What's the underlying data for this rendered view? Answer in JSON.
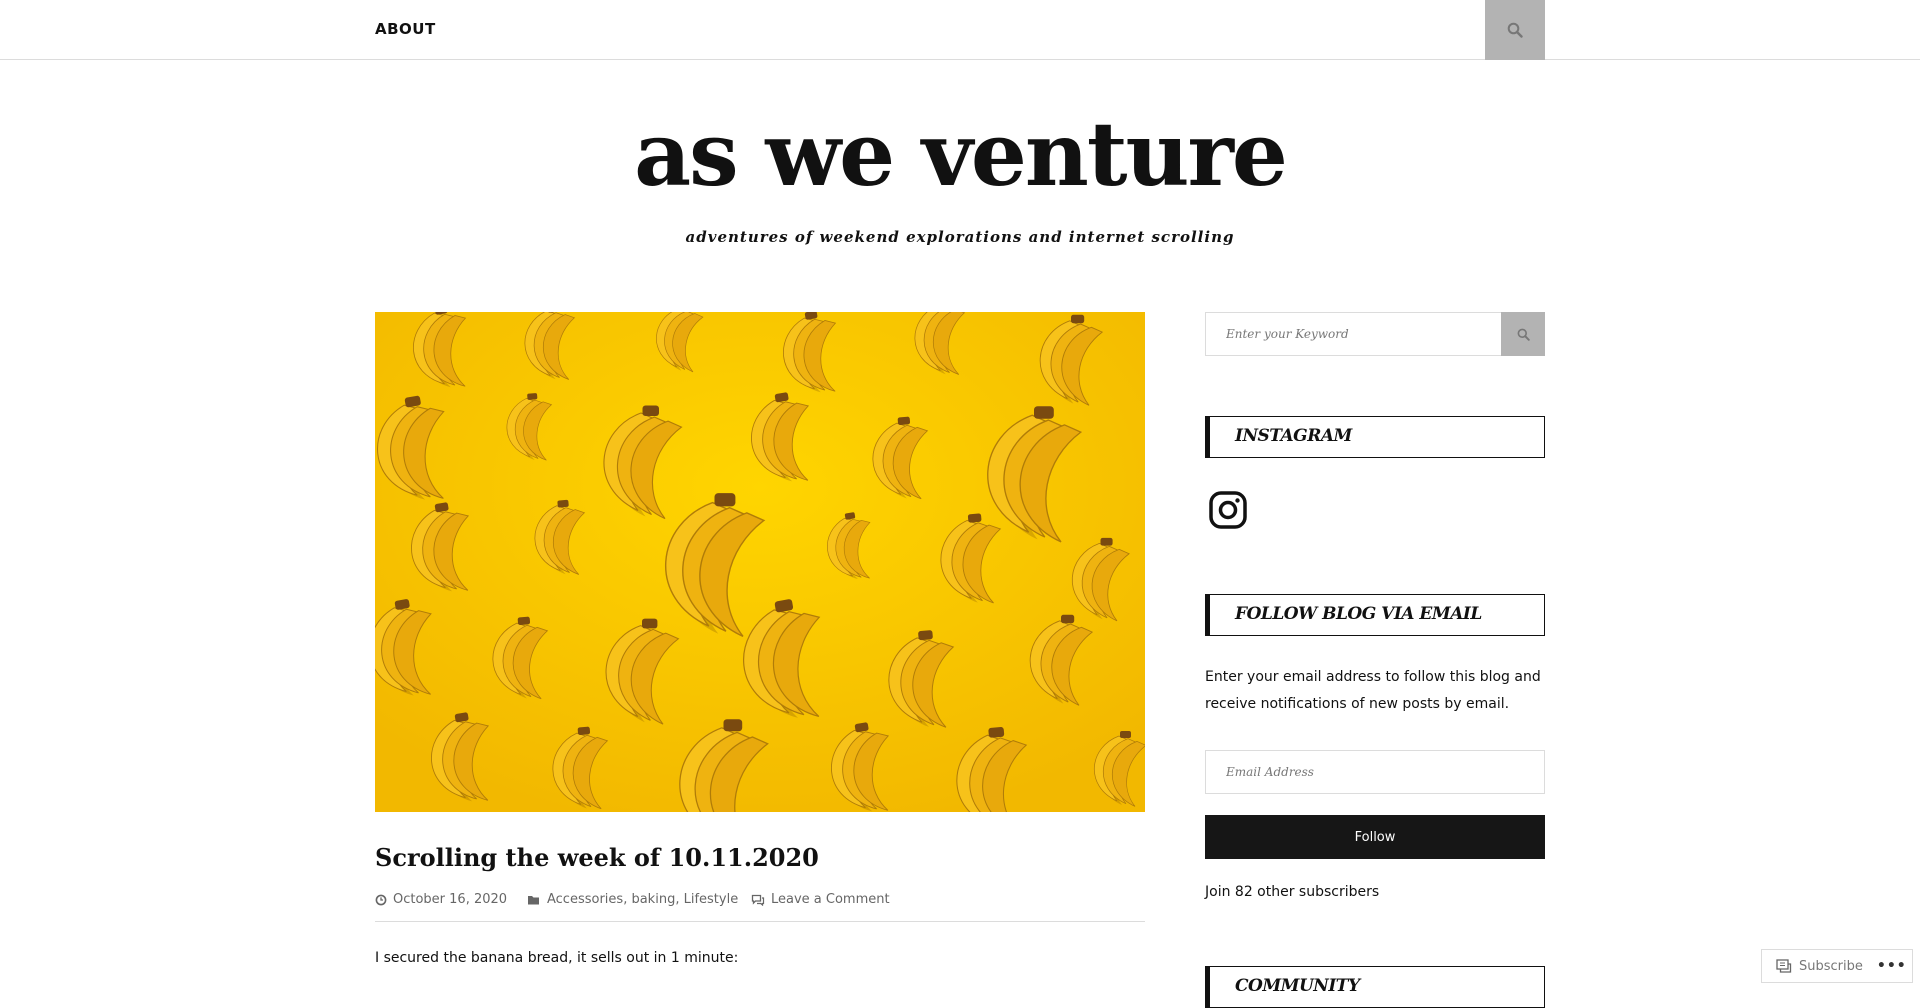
{
  "nav": {
    "items": [
      {
        "label": "ABOUT"
      }
    ]
  },
  "header": {
    "title": "as we venture",
    "tagline": "adventures of weekend explorations and internet scrolling"
  },
  "post": {
    "featured_image": {
      "subject": "bananas on yellow background",
      "background_color": "#f5c800"
    },
    "title": "Scrolling the week of 10.11.2020",
    "date": "October 16, 2020",
    "categories": [
      "Accessories",
      "baking",
      "Lifestyle"
    ],
    "category_separator": ",",
    "comment_link": "Leave a Comment",
    "excerpt": "I secured the banana bread, it sells out in 1 minute:"
  },
  "sidebar": {
    "search": {
      "placeholder": "Enter your Keyword"
    },
    "widgets": {
      "instagram_title": "INSTAGRAM",
      "follow_title": "FOLLOW BLOG VIA EMAIL",
      "follow_description": "Enter your email address to follow this blog and receive notifications of new posts by email.",
      "email_placeholder": "Email Address",
      "follow_button": "Follow",
      "subscribers_text": "Join 82 other subscribers",
      "community_title": "COMMUNITY"
    }
  },
  "subscribe_bar": {
    "subscribe_label": "Subscribe",
    "more_label": "•••"
  },
  "icons": {
    "top_search": "search-icon",
    "sidebar_search": "search-icon",
    "date": "clock-icon",
    "categories": "folder-icon",
    "comments": "comments-icon",
    "instagram": "instagram-icon",
    "subscribe": "reader-icon"
  },
  "colors": {
    "accent_gray": "#b3b3b3",
    "button_dark": "#161616",
    "image_yellow": "#f5c800",
    "text": "#111111",
    "meta_text": "#666666"
  }
}
